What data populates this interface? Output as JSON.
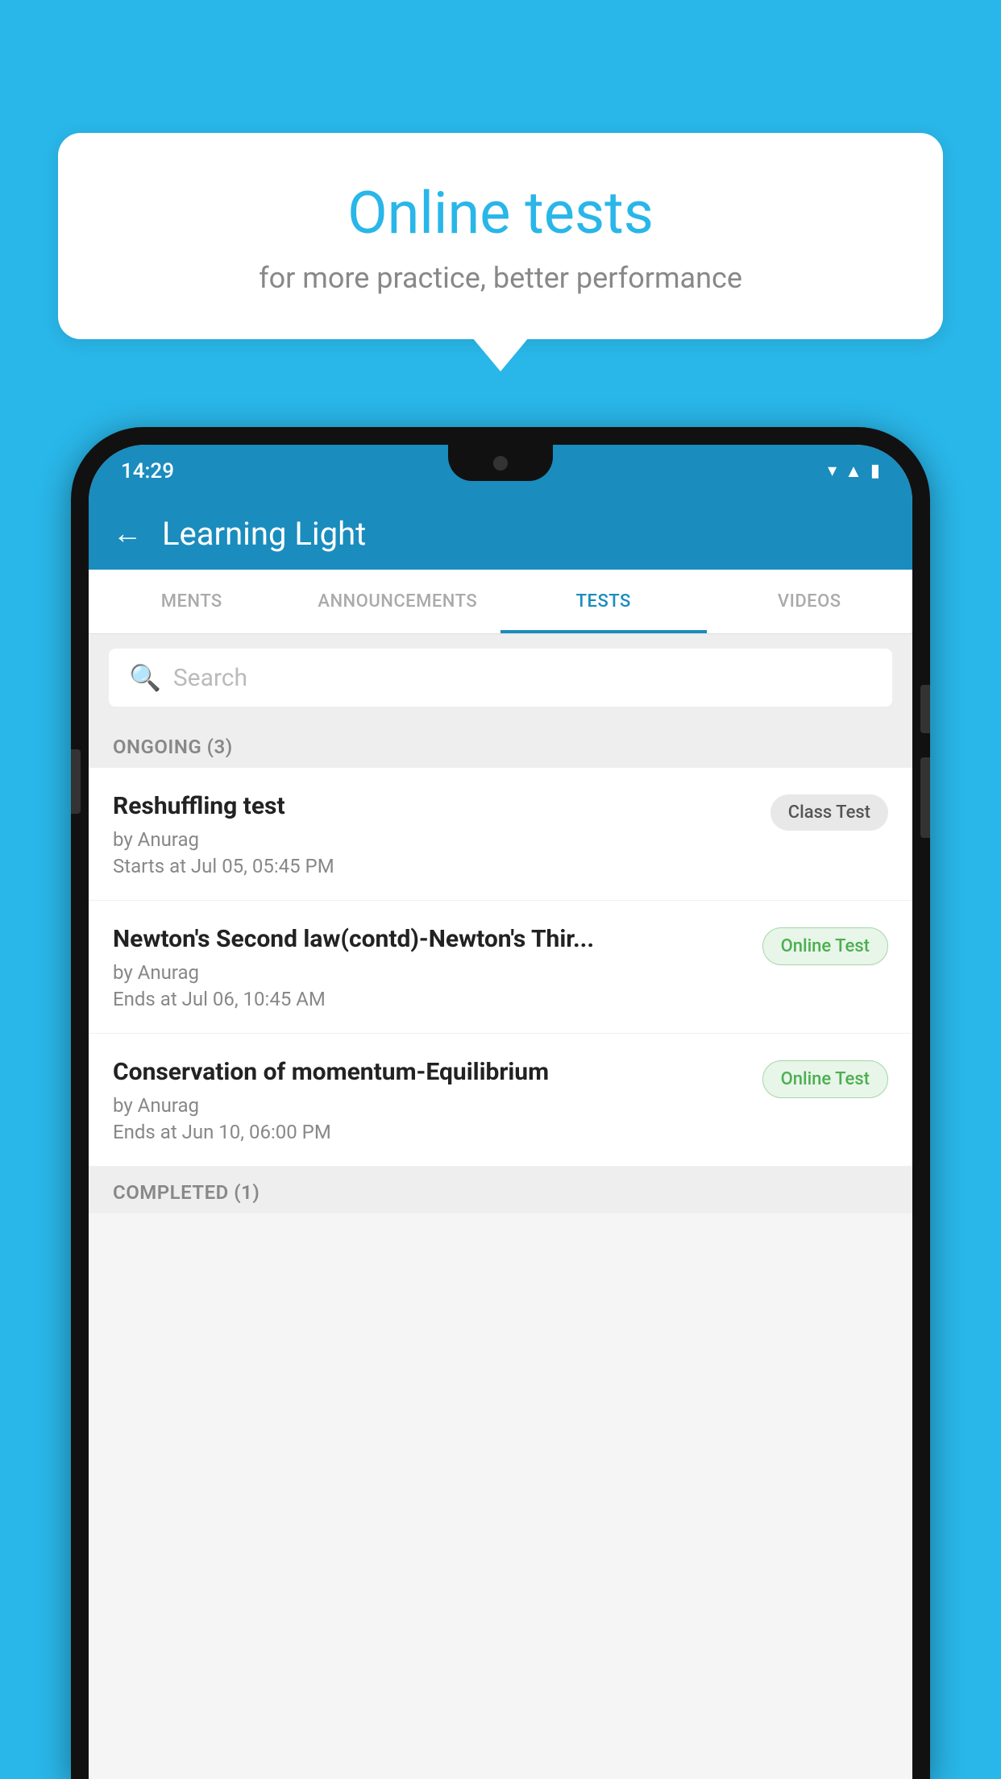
{
  "background_color": "#29b6e8",
  "speech_bubble": {
    "title": "Online tests",
    "subtitle": "for more practice, better performance"
  },
  "phone": {
    "status_bar": {
      "time": "14:29",
      "icons": [
        "wifi",
        "signal",
        "battery"
      ]
    },
    "app_bar": {
      "title": "Learning Light",
      "back_label": "←"
    },
    "tabs": [
      {
        "label": "MENTS",
        "active": false
      },
      {
        "label": "ANNOUNCEMENTS",
        "active": false
      },
      {
        "label": "TESTS",
        "active": true
      },
      {
        "label": "VIDEOS",
        "active": false
      }
    ],
    "search": {
      "placeholder": "Search"
    },
    "ongoing_section": {
      "label": "ONGOING (3)"
    },
    "test_items": [
      {
        "name": "Reshuffling test",
        "author": "by Anurag",
        "time_label": "Starts at  Jul 05, 05:45 PM",
        "badge": "Class Test",
        "badge_type": "class"
      },
      {
        "name": "Newton's Second law(contd)-Newton's Thir...",
        "author": "by Anurag",
        "time_label": "Ends at  Jul 06, 10:45 AM",
        "badge": "Online Test",
        "badge_type": "online"
      },
      {
        "name": "Conservation of momentum-Equilibrium",
        "author": "by Anurag",
        "time_label": "Ends at  Jun 10, 06:00 PM",
        "badge": "Online Test",
        "badge_type": "online"
      }
    ],
    "completed_section": {
      "label": "COMPLETED (1)"
    }
  }
}
